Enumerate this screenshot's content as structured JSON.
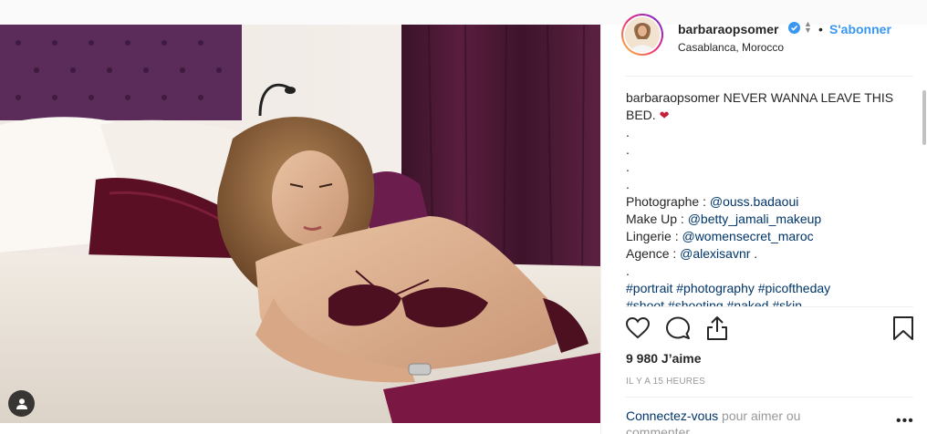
{
  "header": {
    "username": "barbaraopsomer",
    "separator": "•",
    "follow_label": "S'abonner",
    "location": "Casablanca, Morocco"
  },
  "caption": {
    "username": "barbaraopsomer",
    "text": "NEVER WANNA LEAVE THIS BED.",
    "dots": [
      ".",
      ".",
      ".",
      "."
    ],
    "credits": [
      {
        "label": "Photographe : ",
        "handle": "@ouss.badaoui"
      },
      {
        "label": "Make Up : ",
        "handle": "@betty_jamali_makeup"
      },
      {
        "label": "Lingerie : ",
        "handle": "@womensecret_maroc"
      },
      {
        "label": "Agence : ",
        "handle": "@alexisavnr",
        "suffix": " ."
      }
    ],
    "dot_after": ".",
    "hashtags": "#portrait #photography #picoftheday",
    "hashtags_cut": "#shoot #shooting #naked #skin"
  },
  "stats": {
    "likes": "9 980 J’aime",
    "time": "IL Y A 15 HEURES"
  },
  "login": {
    "link": "Connectez-vous",
    "rest": " pour aimer ou commenter."
  },
  "more": "•••",
  "icons": {
    "verified": "verified-badge-icon",
    "like": "heart-icon",
    "comment": "comment-icon",
    "share": "share-icon",
    "save": "bookmark-icon",
    "tag": "user-tag-icon"
  },
  "colors": {
    "accent": "#3897f0",
    "link": "#003569",
    "heart": "#c51e3a"
  }
}
